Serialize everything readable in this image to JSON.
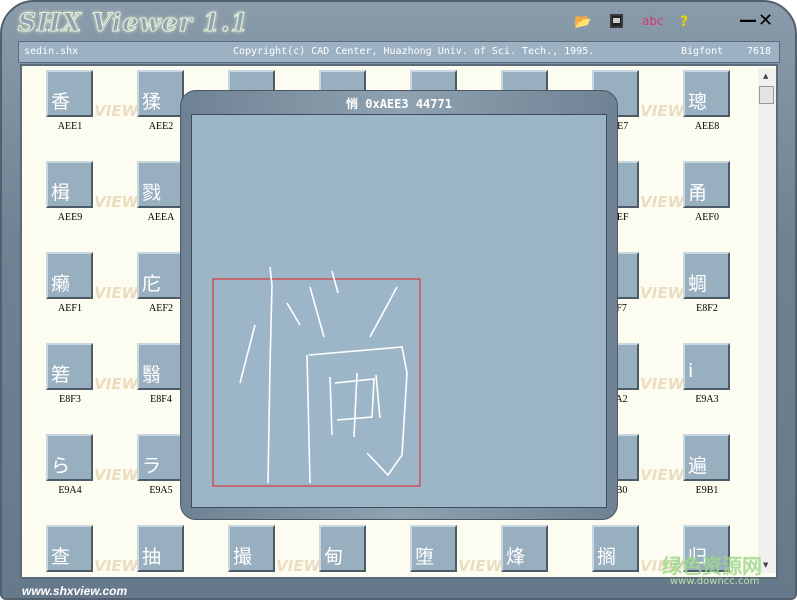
{
  "app": {
    "title": "SHX Viewer 1.1",
    "url": "www.shxview.com"
  },
  "toolbar": {
    "open": "open-folder",
    "save": "save",
    "abc": "abc",
    "help": "?",
    "minimize": "—",
    "close": "✕"
  },
  "info": {
    "file": "sedin.shx",
    "copyright": "Copyright(c) CAD Center, Huazhong Univ. of Sci.  Tech., 1995.",
    "font_type": "Bigfont",
    "count": "7618"
  },
  "watermark": "SHX VIEWER",
  "tiles": [
    {
      "glyph": "香",
      "code": "AEE1"
    },
    {
      "glyph": "猱",
      "code": "AEE2"
    },
    {
      "glyph": "",
      "code": ""
    },
    {
      "glyph": "",
      "code": ""
    },
    {
      "glyph": "",
      "code": ""
    },
    {
      "glyph": "",
      "code": ""
    },
    {
      "glyph": "",
      "code": "AEE7"
    },
    {
      "glyph": "璁",
      "code": "AEE8"
    },
    {
      "glyph": "楫",
      "code": "AEE9"
    },
    {
      "glyph": "戮",
      "code": "AEEA"
    },
    {
      "glyph": "",
      "code": ""
    },
    {
      "glyph": "",
      "code": ""
    },
    {
      "glyph": "",
      "code": ""
    },
    {
      "glyph": "",
      "code": ""
    },
    {
      "glyph": "",
      "code": "AEEF"
    },
    {
      "glyph": "甬",
      "code": "AEF0"
    },
    {
      "glyph": "癞",
      "code": "AEF1"
    },
    {
      "glyph": "庀",
      "code": "AEF2"
    },
    {
      "glyph": "",
      "code": ""
    },
    {
      "glyph": "",
      "code": ""
    },
    {
      "glyph": "",
      "code": ""
    },
    {
      "glyph": "",
      "code": ""
    },
    {
      "glyph": "",
      "code": "E8F7"
    },
    {
      "glyph": "蜩",
      "code": "E8F2"
    },
    {
      "glyph": "箬",
      "code": "E8F3"
    },
    {
      "glyph": "翳",
      "code": "E8F4"
    },
    {
      "glyph": "",
      "code": ""
    },
    {
      "glyph": "",
      "code": ""
    },
    {
      "glyph": "",
      "code": ""
    },
    {
      "glyph": "",
      "code": ""
    },
    {
      "glyph": "",
      "code": "E9A2"
    },
    {
      "glyph": "i",
      "code": "E9A3"
    },
    {
      "glyph": "ら",
      "code": "E9A4"
    },
    {
      "glyph": "ラ",
      "code": "E9A5"
    },
    {
      "glyph": "",
      "code": ""
    },
    {
      "glyph": "",
      "code": ""
    },
    {
      "glyph": "",
      "code": ""
    },
    {
      "glyph": "",
      "code": ""
    },
    {
      "glyph": "",
      "code": "E9B0"
    },
    {
      "glyph": "遍",
      "code": "E9B1"
    },
    {
      "glyph": "查",
      "code": ""
    },
    {
      "glyph": "抽",
      "code": ""
    },
    {
      "glyph": "撮",
      "code": ""
    },
    {
      "glyph": "甸",
      "code": ""
    },
    {
      "glyph": "堕",
      "code": ""
    },
    {
      "glyph": "烽",
      "code": ""
    },
    {
      "glyph": "搁",
      "code": ""
    },
    {
      "glyph": "归",
      "code": ""
    }
  ],
  "dialog": {
    "title": "悄 0xAEE3 44771",
    "glyph": "悄"
  },
  "site_watermark": {
    "name": "绿色资源网",
    "url": "www.downcc.com"
  },
  "colors": {
    "frame": "#6f8293",
    "tile": "#98afc0",
    "content": "#fdfcf1",
    "box": "#e02020"
  }
}
